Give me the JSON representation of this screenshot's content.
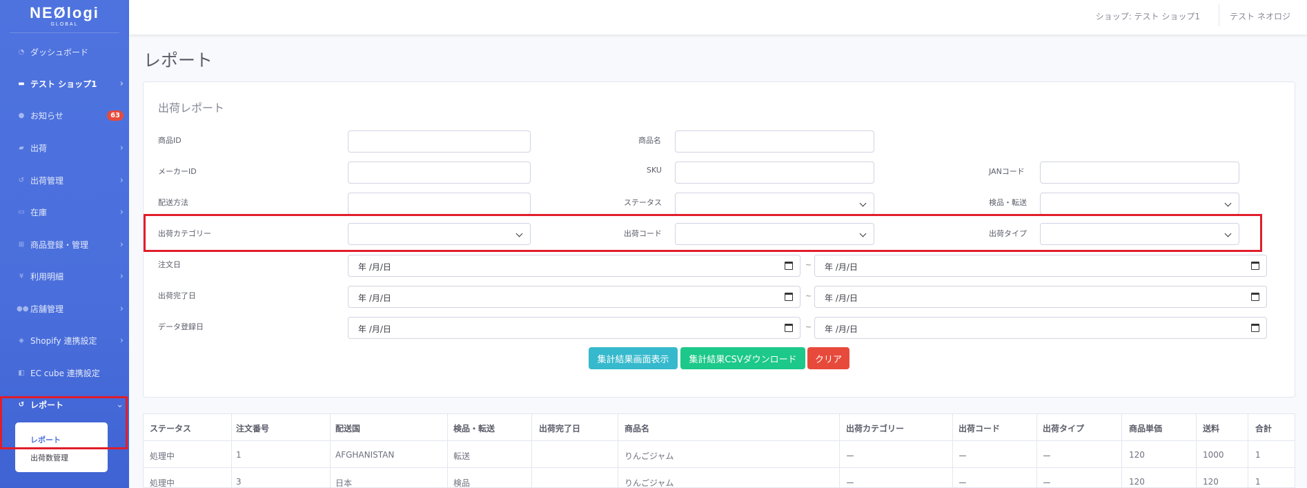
{
  "brand": {
    "name": "NEØlogi",
    "sub": "GLOBAL"
  },
  "sidebar": {
    "items": [
      {
        "label": "ダッシュボード",
        "icon": "dashboard-icon"
      },
      {
        "label": "テスト ショップ1",
        "icon": "store-icon"
      },
      {
        "label": "お知らせ",
        "icon": "bell-icon",
        "badge": "63"
      },
      {
        "label": "出荷",
        "icon": "truck-icon"
      },
      {
        "label": "出荷管理",
        "icon": "history-icon"
      },
      {
        "label": "在庫",
        "icon": "warehouse-icon"
      },
      {
        "label": "商品登録・管理",
        "icon": "sitemap-icon"
      },
      {
        "label": "利用明細",
        "icon": "yen-icon"
      },
      {
        "label": "店舗管理",
        "icon": "users-icon"
      },
      {
        "label": "Shopify 連携設定",
        "icon": "shopify-icon"
      },
      {
        "label": "EC cube 連携設定",
        "icon": "cube-icon"
      },
      {
        "label": "レポート",
        "icon": "history-icon"
      }
    ],
    "sub_items": [
      {
        "label": "レポート",
        "active": true
      },
      {
        "label": "出荷数管理",
        "active": false
      }
    ]
  },
  "topbar": {
    "shop": "ショップ: テスト ショップ1",
    "user": "テスト ネオロジ"
  },
  "page": {
    "title": "レポート"
  },
  "form": {
    "title": "出荷レポート",
    "labels": {
      "product_id": "商品ID",
      "product_name": "商品名",
      "maker_id": "メーカーID",
      "sku": "SKU",
      "jan": "JANコード",
      "shipping_method": "配送方法",
      "status": "ステータス",
      "inspect": "検品・転送",
      "ship_category": "出荷カテゴリー",
      "ship_code": "出荷コード",
      "ship_type": "出荷タイプ",
      "order_date": "注文日",
      "ship_done_date": "出荷完了日",
      "data_date": "データ登録日"
    },
    "date_placeholder": "年 /月/日",
    "tilde": "~",
    "buttons": {
      "show": "集計結果画面表示",
      "csv": "集計結果CSVダウンロード",
      "clear": "クリア"
    }
  },
  "table": {
    "headers": [
      "ステータス",
      "注文番号",
      "配送国",
      "検品・転送",
      "出荷完了日",
      "商品名",
      "出荷カテゴリー",
      "出荷コード",
      "出荷タイプ",
      "商品単価",
      "送料",
      "合計"
    ],
    "rows": [
      [
        "処理中",
        "1",
        "AFGHANISTAN",
        "転送",
        "",
        "りんごジャム",
        "ー",
        "ー",
        "ー",
        "120",
        "1000",
        "1"
      ],
      [
        "処理中",
        "3",
        "日本",
        "検品",
        "",
        "りんごジャム",
        "ー",
        "ー",
        "ー",
        "120",
        "120",
        "1"
      ]
    ]
  },
  "colors": {
    "sidebar": "#4e73df",
    "btn_show": "#36b9cc",
    "btn_csv": "#1cc88a",
    "btn_clear": "#e74a3b",
    "highlight": "#e11d2a"
  }
}
